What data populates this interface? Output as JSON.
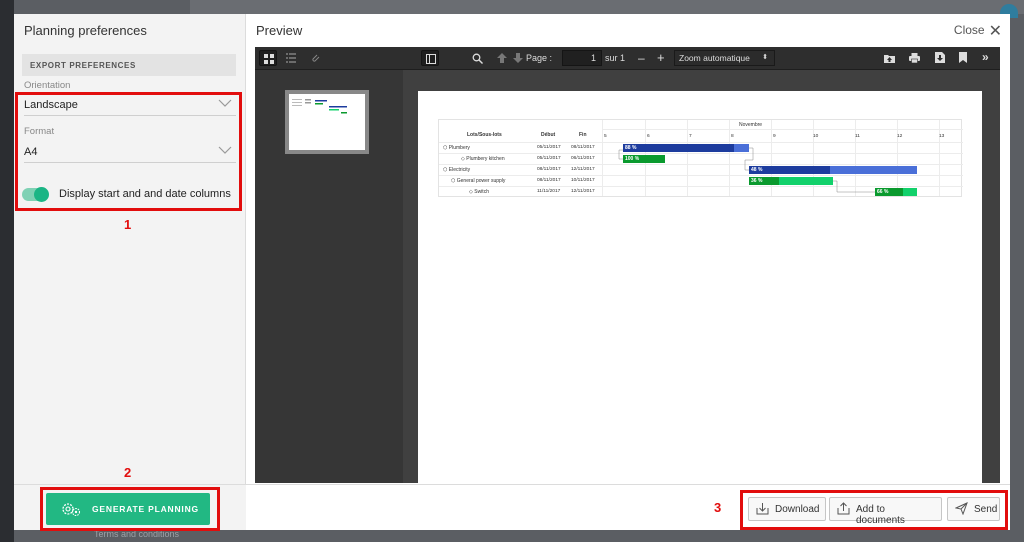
{
  "left_panel": {
    "title": "Planning preferences",
    "section_header": "EXPORT PREFERENCES",
    "orientation": {
      "label": "Orientation",
      "value": "Landscape"
    },
    "format": {
      "label": "Format",
      "value": "A4"
    },
    "toggle": {
      "label": "Display start and and date columns",
      "on": true
    },
    "generate_button": "GENERATE PLANNING"
  },
  "preview": {
    "title": "Preview",
    "close_label": "Close"
  },
  "viewer": {
    "page_label": "Page :",
    "page_value": "1",
    "of_label": "sur 1",
    "zoom": "Zoom automatique"
  },
  "gantt": {
    "headers": {
      "lots": "Lots/Sous-lots",
      "start": "Début",
      "end": "Fin",
      "month": "Novembre"
    },
    "days": [
      "5",
      "6",
      "7",
      "8",
      "9",
      "10",
      "11",
      "12",
      "13"
    ],
    "rows": [
      {
        "name": "Plumbery",
        "start": "05/11/2017",
        "end": "08/11/2017",
        "progress": "88 %",
        "level": 0
      },
      {
        "name": "Plumbery kitchen",
        "start": "05/11/2017",
        "end": "06/11/2017",
        "progress": "100 %",
        "level": 1
      },
      {
        "name": "Electricity",
        "start": "08/11/2017",
        "end": "12/11/2017",
        "progress": "48 %",
        "level": 0
      },
      {
        "name": "General power supply",
        "start": "08/11/2017",
        "end": "10/11/2017",
        "progress": "36 %",
        "level": 1
      },
      {
        "name": "Switch",
        "start": "11/11/2017",
        "end": "12/11/2017",
        "progress": "66 %",
        "level": 2
      }
    ]
  },
  "footer": {
    "download": "Download",
    "add_to_documents": "Add to documents",
    "send": "Send"
  },
  "annotations": {
    "one": "1",
    "two": "2",
    "three": "3"
  },
  "background": {
    "footer_text": "Terms and conditions"
  },
  "colors": {
    "accent": "#22b883",
    "annotation": "#e20d0d",
    "bar_blue": "#1d3c9e",
    "bar_green": "#0a9a2e"
  }
}
